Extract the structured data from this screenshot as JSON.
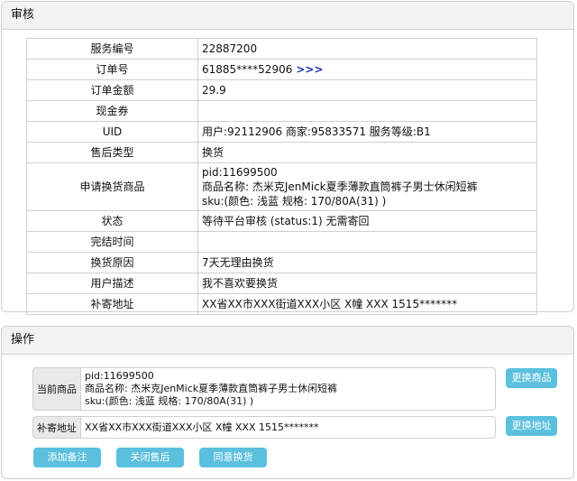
{
  "review": {
    "title": "审核",
    "rows": [
      {
        "label": "服务编号",
        "value": "22887200"
      },
      {
        "label": "订单号",
        "value": "61885****52906",
        "link": ">>>"
      },
      {
        "label": "订单金额",
        "value": "29.9"
      },
      {
        "label": "现金券",
        "value": ""
      },
      {
        "label": "UID",
        "value": "用户:92112906  商家:95833571 服务等级:B1"
      },
      {
        "label": "售后类型",
        "value": "换货"
      },
      {
        "label": "申请换货商品",
        "lines": [
          "pid:11699500",
          "商品名称:  杰米克JenMick夏季薄款直筒裤子男士休闲短裤",
          "sku:(颜色:  浅蓝    规格:  170/80A(31)  )"
        ]
      },
      {
        "label": "状态",
        "value": "等待平台审核 (status:1) 无需寄回"
      },
      {
        "label": "完结时间",
        "value": ""
      },
      {
        "label": "换货原因",
        "value": "7天无理由换货"
      },
      {
        "label": "用户描述",
        "value": "我不喜欢要换货"
      },
      {
        "label": "补寄地址",
        "value": "XX省XX市XXX街道XXX小区 X幢    XXX 1515*******"
      }
    ]
  },
  "ops": {
    "title": "操作",
    "current_item": {
      "label": "当前商品",
      "lines": [
        "pid:11699500",
        "商品名称:  杰米克JenMick夏季薄款直筒裤子男士休闲短裤",
        "sku:(颜色:  浅蓝    规格:  170/80A(31)  )"
      ],
      "button": "更换商品"
    },
    "address": {
      "label": "补寄地址",
      "value": "XX省XX市XXX街道XXX小区 X幢    XXX 1515*******",
      "button": "更换地址"
    },
    "actions": {
      "add_note": "添加备注",
      "close": "关闭售后",
      "approve": "同意换货"
    }
  },
  "colors": {
    "button": "#5bc0de",
    "link": "#1a2fa8",
    "header_bg": "#f2f2f2"
  }
}
